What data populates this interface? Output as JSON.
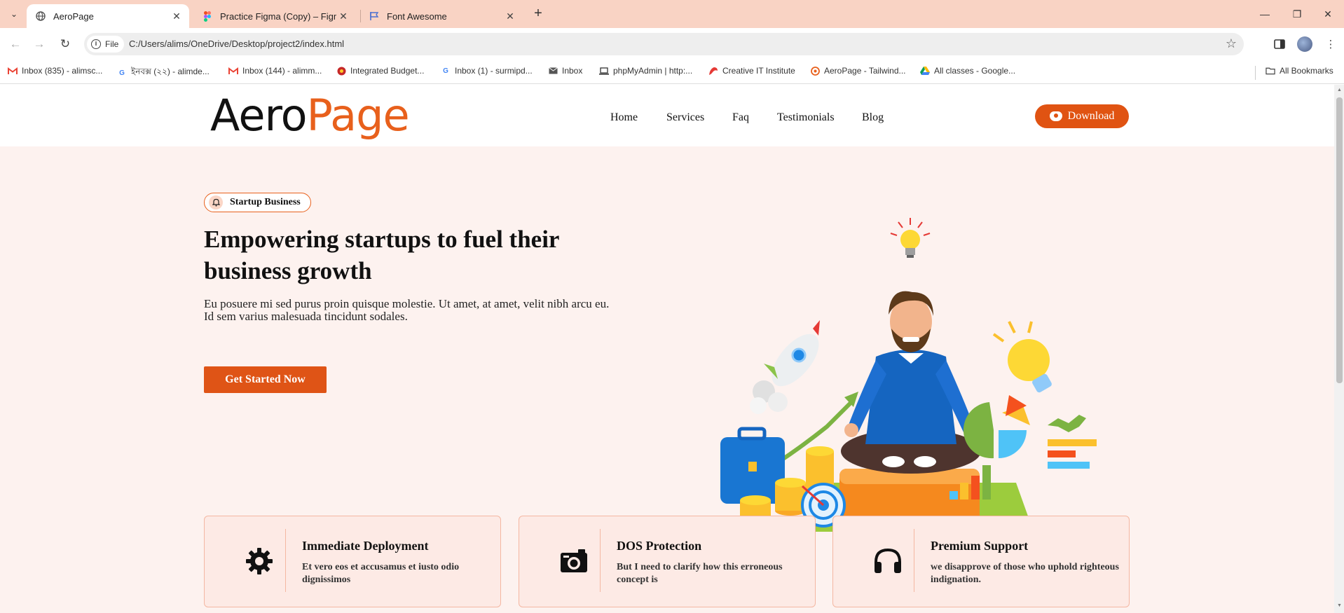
{
  "browser": {
    "tabs": [
      {
        "title": "AeroPage",
        "favicon": "globe-icon",
        "active": true
      },
      {
        "title": "Practice Figma (Copy) – Figma",
        "favicon": "figma-icon",
        "active": false
      },
      {
        "title": "Font Awesome",
        "favicon": "flag-icon",
        "active": false
      }
    ],
    "address": {
      "chip_label": "File",
      "url": "C:/Users/alims/OneDrive/Desktop/project2/index.html"
    },
    "bookmarks": [
      {
        "label": "Inbox (835) - alimsc...",
        "icon": "gmail-icon"
      },
      {
        "label": "ইনবক্স (২২) - alimde...",
        "icon": "google-icon"
      },
      {
        "label": "Inbox (144) - alimm...",
        "icon": "gmail-icon"
      },
      {
        "label": "Integrated Budget...",
        "icon": "budget-icon"
      },
      {
        "label": "Inbox (1) - surmipd...",
        "icon": "google-icon"
      },
      {
        "label": "Inbox",
        "icon": "mail-icon"
      },
      {
        "label": "phpMyAdmin | http:...",
        "icon": "laptop-icon"
      },
      {
        "label": "Creative IT Institute",
        "icon": "creative-it-icon"
      },
      {
        "label": "AeroPage - Tailwind...",
        "icon": "aeropage-icon"
      },
      {
        "label": "All classes - Google...",
        "icon": "drive-icon"
      }
    ],
    "all_bookmarks_label": "All Bookmarks"
  },
  "site": {
    "logo": {
      "part1": "Aero",
      "part2": "Page"
    },
    "nav": [
      "Home",
      "Services",
      "Faq",
      "Testimonials",
      "Blog"
    ],
    "download_label": "Download",
    "colors": {
      "accent": "#e05312",
      "hero_bg": "#fdf2ef",
      "card_bg": "#fdeae5"
    }
  },
  "hero": {
    "badge": "Startup Business",
    "title": "Empowering startups to fuel their business growth",
    "description": "Eu posuere mi sed purus proin quisque molestie. Ut amet, at amet, velit nibh arcu eu. Id sem varius malesuada tincidunt sodales.",
    "cta": "Get Started Now"
  },
  "features": [
    {
      "icon": "gear-icon",
      "title": "Immediate Deployment",
      "text": "Et vero eos et accusamus et iusto odio dignissimos"
    },
    {
      "icon": "camera-icon",
      "title": "DOS Protection",
      "text": "But I need to clarify how this erroneous concept is"
    },
    {
      "icon": "headphones-icon",
      "title": "Premium Support",
      "text": "we disapprove of those who uphold righteous indignation."
    }
  ]
}
